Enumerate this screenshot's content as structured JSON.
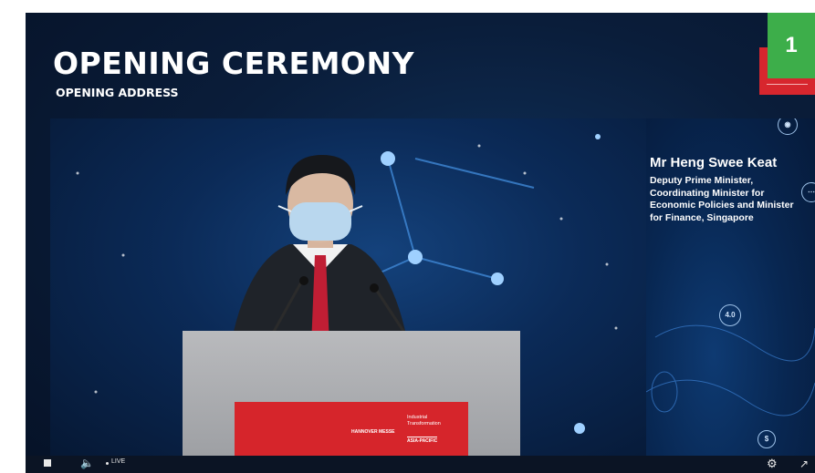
{
  "header": {
    "title": "OPENING CEREMONY",
    "subtitle": "OPENING ADDRESS",
    "badge": "1"
  },
  "speaker": {
    "name": "Mr Heng Swee Keat",
    "role": "Deputy Prime Minister, Coordinating Minister for Economic Policies and Minister for Finance, Singapore"
  },
  "podium_sign": {
    "brand": "HANNOVER MESSE",
    "event_line": "Industrial Transformation",
    "region": "ASIA-PACIFIC"
  },
  "panel_icons": [
    "user-icon",
    "network-icon",
    "industry-4-0-icon",
    "dollar-icon"
  ],
  "panel_icon_labels": {
    "industry": "4.0"
  },
  "player": {
    "live_label": "LIVE",
    "icons": [
      "stop-icon",
      "volume-icon",
      "settings-gear-icon",
      "fullscreen-icon"
    ]
  },
  "colors": {
    "background_navy": "#0a1d3a",
    "badge_green": "#3dae4a",
    "logo_red": "#d7262e",
    "text_white": "#ffffff"
  }
}
